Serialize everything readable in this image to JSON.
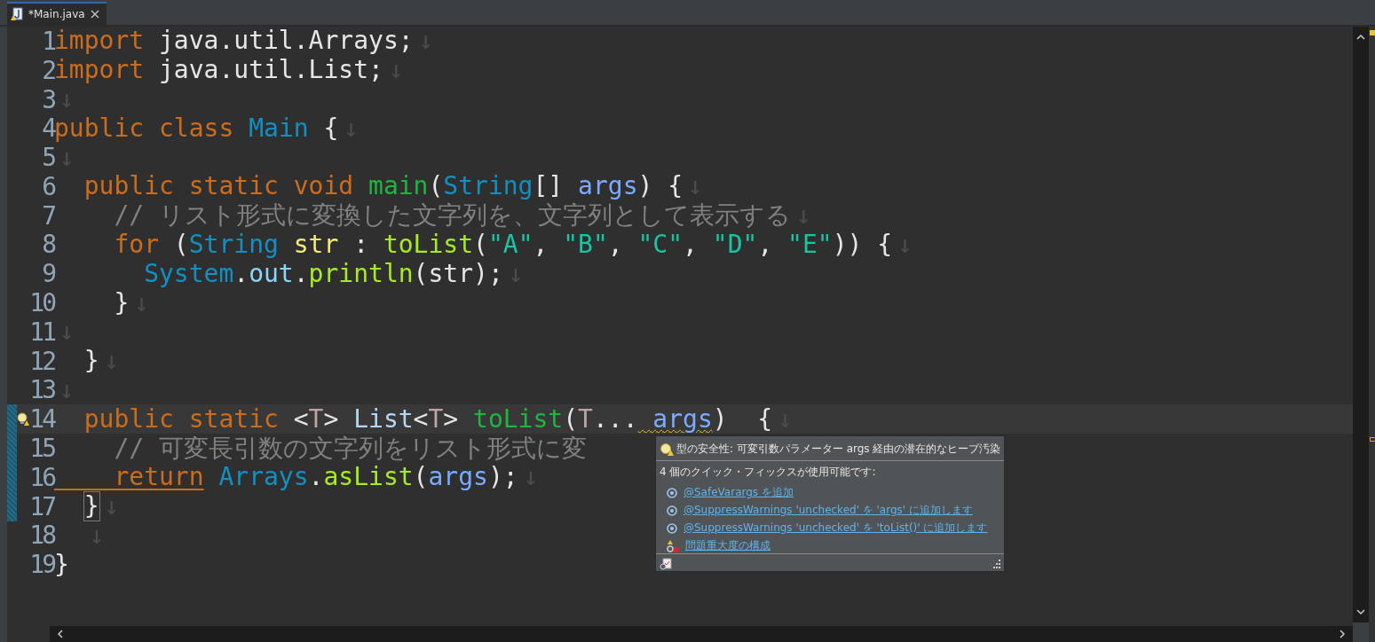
{
  "tab": {
    "title": "*Main.java"
  },
  "editor": {
    "lines": [
      {
        "number": "1",
        "current": false,
        "changed": false,
        "warning": false,
        "tokens": [
          {
            "kind": "keyword",
            "text": "import"
          },
          {
            "kind": "plain",
            "text": " java.util.Arrays;"
          },
          {
            "kind": "eol",
            "text": "↓"
          }
        ]
      },
      {
        "number": "2",
        "current": false,
        "changed": false,
        "warning": false,
        "tokens": [
          {
            "kind": "keyword",
            "text": "import"
          },
          {
            "kind": "plain",
            "text": " java.util.List;"
          },
          {
            "kind": "eol",
            "text": "↓"
          }
        ]
      },
      {
        "number": "3",
        "current": false,
        "changed": false,
        "warning": false,
        "tokens": [
          {
            "kind": "eol",
            "text": "↓"
          }
        ]
      },
      {
        "number": "4",
        "current": false,
        "changed": false,
        "warning": false,
        "tokens": [
          {
            "kind": "keyword",
            "text": "public"
          },
          {
            "kind": "keyword",
            "text": " class"
          },
          {
            "kind": "type",
            "text": " Main"
          },
          {
            "kind": "plain",
            "text": " {"
          },
          {
            "kind": "eol",
            "text": "↓"
          }
        ]
      },
      {
        "number": "5",
        "current": false,
        "changed": false,
        "warning": false,
        "tokens": [
          {
            "kind": "eol",
            "text": "↓"
          }
        ]
      },
      {
        "number": "6",
        "current": false,
        "changed": false,
        "warning": false,
        "tokens": [
          {
            "kind": "keyword",
            "text": "  public"
          },
          {
            "kind": "keyword",
            "text": " static"
          },
          {
            "kind": "keyword",
            "text": " void"
          },
          {
            "kind": "method",
            "text": " main"
          },
          {
            "kind": "plain",
            "text": "("
          },
          {
            "kind": "type",
            "text": "String"
          },
          {
            "kind": "plain",
            "text": "[]"
          },
          {
            "kind": "param",
            "text": " args"
          },
          {
            "kind": "plain",
            "text": ") {"
          },
          {
            "kind": "eol",
            "text": "↓"
          }
        ]
      },
      {
        "number": "7",
        "current": false,
        "changed": false,
        "warning": false,
        "tokens": [
          {
            "kind": "comment",
            "text": "    // リスト形式に変換した文字列を、文字列として表示する"
          },
          {
            "kind": "eol",
            "text": "↓"
          }
        ]
      },
      {
        "number": "8",
        "current": false,
        "changed": false,
        "warning": false,
        "tokens": [
          {
            "kind": "keyword",
            "text": "    for"
          },
          {
            "kind": "plain",
            "text": " ("
          },
          {
            "kind": "type",
            "text": "String"
          },
          {
            "kind": "variable",
            "text": " str"
          },
          {
            "kind": "plain",
            "text": " :"
          },
          {
            "kind": "call",
            "text": " toList"
          },
          {
            "kind": "plain",
            "text": "("
          },
          {
            "kind": "string",
            "text": "\"A\""
          },
          {
            "kind": "plain",
            "text": ","
          },
          {
            "kind": "string",
            "text": " \"B\""
          },
          {
            "kind": "plain",
            "text": ","
          },
          {
            "kind": "string",
            "text": " \"C\""
          },
          {
            "kind": "plain",
            "text": ","
          },
          {
            "kind": "string",
            "text": " \"D\""
          },
          {
            "kind": "plain",
            "text": ","
          },
          {
            "kind": "string",
            "text": " \"E\""
          },
          {
            "kind": "plain",
            "text": ")) {"
          },
          {
            "kind": "eol",
            "text": "↓"
          }
        ]
      },
      {
        "number": "9",
        "current": false,
        "changed": false,
        "warning": false,
        "tokens": [
          {
            "kind": "type",
            "text": "      System"
          },
          {
            "kind": "plain",
            "text": "."
          },
          {
            "kind": "field",
            "text": "out"
          },
          {
            "kind": "plain",
            "text": "."
          },
          {
            "kind": "call",
            "text": "println"
          },
          {
            "kind": "plain",
            "text": "(str);"
          },
          {
            "kind": "eol",
            "text": "↓"
          }
        ]
      },
      {
        "number": "10",
        "current": false,
        "changed": false,
        "warning": false,
        "tokens": [
          {
            "kind": "plain",
            "text": "    }"
          },
          {
            "kind": "eol",
            "text": "↓"
          }
        ]
      },
      {
        "number": "11",
        "current": false,
        "changed": false,
        "warning": false,
        "tokens": [
          {
            "kind": "eol",
            "text": "↓"
          }
        ]
      },
      {
        "number": "12",
        "current": false,
        "changed": false,
        "warning": false,
        "tokens": [
          {
            "kind": "plain",
            "text": "  }"
          },
          {
            "kind": "eol",
            "text": "↓"
          }
        ]
      },
      {
        "number": "13",
        "current": false,
        "changed": false,
        "warning": false,
        "tokens": [
          {
            "kind": "eol",
            "text": "↓"
          }
        ]
      },
      {
        "number": "14",
        "current": true,
        "changed": true,
        "warning": true,
        "tokens": [
          {
            "kind": "keyword",
            "text": "  public"
          },
          {
            "kind": "keyword",
            "text": " static"
          },
          {
            "kind": "plain",
            "text": " <"
          },
          {
            "kind": "typeparam",
            "text": "T"
          },
          {
            "kind": "plain",
            "text": ">"
          },
          {
            "kind": "interface",
            "text": " List"
          },
          {
            "kind": "plain",
            "text": "<"
          },
          {
            "kind": "typeparam",
            "text": "T"
          },
          {
            "kind": "plain",
            "text": ">"
          },
          {
            "kind": "method",
            "text": " toList"
          },
          {
            "kind": "plain",
            "text": "("
          },
          {
            "kind": "typeparam",
            "text": "T"
          },
          {
            "kind": "plain",
            "text": "..."
          },
          {
            "kind": "warned",
            "text": " args"
          },
          {
            "kind": "plain",
            "text": ")  {"
          },
          {
            "kind": "eol",
            "text": "↓"
          }
        ]
      },
      {
        "number": "15",
        "current": false,
        "changed": true,
        "warning": false,
        "tokens": [
          {
            "kind": "comment",
            "text": "    // 可変長引数の文字列をリスト形式に変"
          }
        ]
      },
      {
        "number": "16",
        "current": false,
        "changed": true,
        "warning": false,
        "tokens": [
          {
            "kind": "occurrence",
            "text": "    return"
          },
          {
            "kind": "type",
            "text": " Arrays"
          },
          {
            "kind": "plain",
            "text": "."
          },
          {
            "kind": "call",
            "text": "asList"
          },
          {
            "kind": "plain",
            "text": "("
          },
          {
            "kind": "param",
            "text": "args"
          },
          {
            "kind": "plain",
            "text": ");"
          },
          {
            "kind": "eol",
            "text": "↓"
          }
        ]
      },
      {
        "number": "17",
        "current": false,
        "changed": true,
        "warning": false,
        "tokens": [
          {
            "kind": "bracket",
            "text": "}"
          },
          {
            "kind": "eol",
            "text": "↓"
          }
        ]
      },
      {
        "number": "18",
        "current": false,
        "changed": false,
        "warning": false,
        "tokens": [
          {
            "kind": "eol",
            "text": "  ↓"
          }
        ]
      },
      {
        "number": "19",
        "current": false,
        "changed": false,
        "warning": false,
        "tokens": [
          {
            "kind": "plain",
            "text": "}"
          }
        ]
      }
    ]
  },
  "quick_fix_popup": {
    "title": "型の安全性: 可変引数パラメーター args 経由の潜在的なヒープ汚染",
    "subtitle": "4 個のクイック・フィックスが使用可能です:",
    "fixes": [
      {
        "kind": "annotation",
        "text": "@SafeVarargs を追加"
      },
      {
        "kind": "annotation",
        "text": "@SuppressWarnings 'unchecked' を 'args' に追加します"
      },
      {
        "kind": "annotation",
        "text": "@SuppressWarnings 'unchecked' を 'toList()' に追加します"
      },
      {
        "kind": "configure",
        "text": "問題重大度の構成"
      }
    ]
  }
}
